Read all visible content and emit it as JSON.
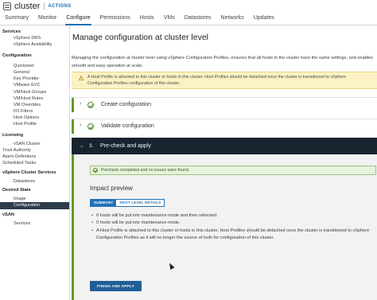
{
  "header": {
    "object_name": "cluster",
    "actions_label": "ACTIONS",
    "tabs": [
      {
        "label": "Summary",
        "active": false
      },
      {
        "label": "Monitor",
        "active": false
      },
      {
        "label": "Configure",
        "active": true
      },
      {
        "label": "Permissions",
        "active": false
      },
      {
        "label": "Hosts",
        "active": false
      },
      {
        "label": "VMs",
        "active": false
      },
      {
        "label": "Datastores",
        "active": false
      },
      {
        "label": "Networks",
        "active": false
      },
      {
        "label": "Updates",
        "active": false
      }
    ]
  },
  "sidebar": {
    "items": [
      {
        "label": "Services",
        "kind": "head"
      },
      {
        "label": "vSphere DRS",
        "kind": "item"
      },
      {
        "label": "vSphere Availability",
        "kind": "item"
      },
      {
        "label": "Configuration",
        "kind": "head"
      },
      {
        "label": "Quickstart",
        "kind": "item"
      },
      {
        "label": "General",
        "kind": "item"
      },
      {
        "label": "Key Provider",
        "kind": "item"
      },
      {
        "label": "VMware EVC",
        "kind": "item"
      },
      {
        "label": "VM/Host Groups",
        "kind": "item"
      },
      {
        "label": "VM/Host Rules",
        "kind": "item"
      },
      {
        "label": "VM Overrides",
        "kind": "item"
      },
      {
        "label": "I/O Filters",
        "kind": "item"
      },
      {
        "label": "Host Options",
        "kind": "item"
      },
      {
        "label": "Host Profile",
        "kind": "item"
      },
      {
        "label": "Licensing",
        "kind": "head"
      },
      {
        "label": "vSAN Cluster",
        "kind": "item"
      },
      {
        "label": "Trust Authority",
        "kind": "plain"
      },
      {
        "label": "Alarm Definitions",
        "kind": "plain"
      },
      {
        "label": "Scheduled Tasks",
        "kind": "plain"
      },
      {
        "label": "vSphere Cluster Services",
        "kind": "head"
      },
      {
        "label": "Datastores",
        "kind": "item"
      },
      {
        "label": "Desired State",
        "kind": "head"
      },
      {
        "label": "Image",
        "kind": "item"
      },
      {
        "label": "Configuration",
        "kind": "item",
        "selected": true
      },
      {
        "label": "vSAN",
        "kind": "head"
      },
      {
        "label": "Services",
        "kind": "item"
      }
    ]
  },
  "main": {
    "title": "Manage configuration at cluster level",
    "description": "Managing the configuration at cluster level using vSphere Configuration Profiles, ensures that all hosts in the cluster have the same settings, and enables smooth and easy operation at scale.",
    "warning": "A Host Profile is attached to this cluster or hosts in this cluster. Host Profiles should be detached once the cluster is transitioned to vSphere Configuration Profiles configuration of this cluster.",
    "steps": [
      {
        "label": "Create configuration",
        "status": "done"
      },
      {
        "label": "Validate configuration",
        "status": "done"
      },
      {
        "number": "3.",
        "label": "Pre-check and apply",
        "status": "active"
      }
    ],
    "success_message": "Precheck completed and no issues were found.",
    "impact_title": "Impact preview",
    "toggle": {
      "summary": "SUMMARY",
      "details": "HOST LEVEL DETAILS"
    },
    "impact_items": [
      "0 hosts will be put into maintenance mode and then rebooted.",
      "0 hosts will be put into maintenance mode.",
      "A Host Profile is attached to this cluster or hosts in this cluster. Host Profiles should be detached once the cluster is transitioned to vSphere Configuration Profiles as it will no longer the source of truth for configuration of this cluster."
    ],
    "finish_button": "FINISH AND APPLY"
  },
  "colors": {
    "accent": "#1f73b7",
    "step_done": "#5e9b2e",
    "active_step_bg": "#17242f",
    "warning_bg": "#fbf2c4",
    "success_bg": "#e6f2dc",
    "sidebar_selected": "#2d3b4a"
  },
  "icons": [
    "cluster-icon",
    "warning-icon",
    "check-circle-icon",
    "chevron-right-icon",
    "chevron-down-icon",
    "mouse-cursor-icon"
  ]
}
